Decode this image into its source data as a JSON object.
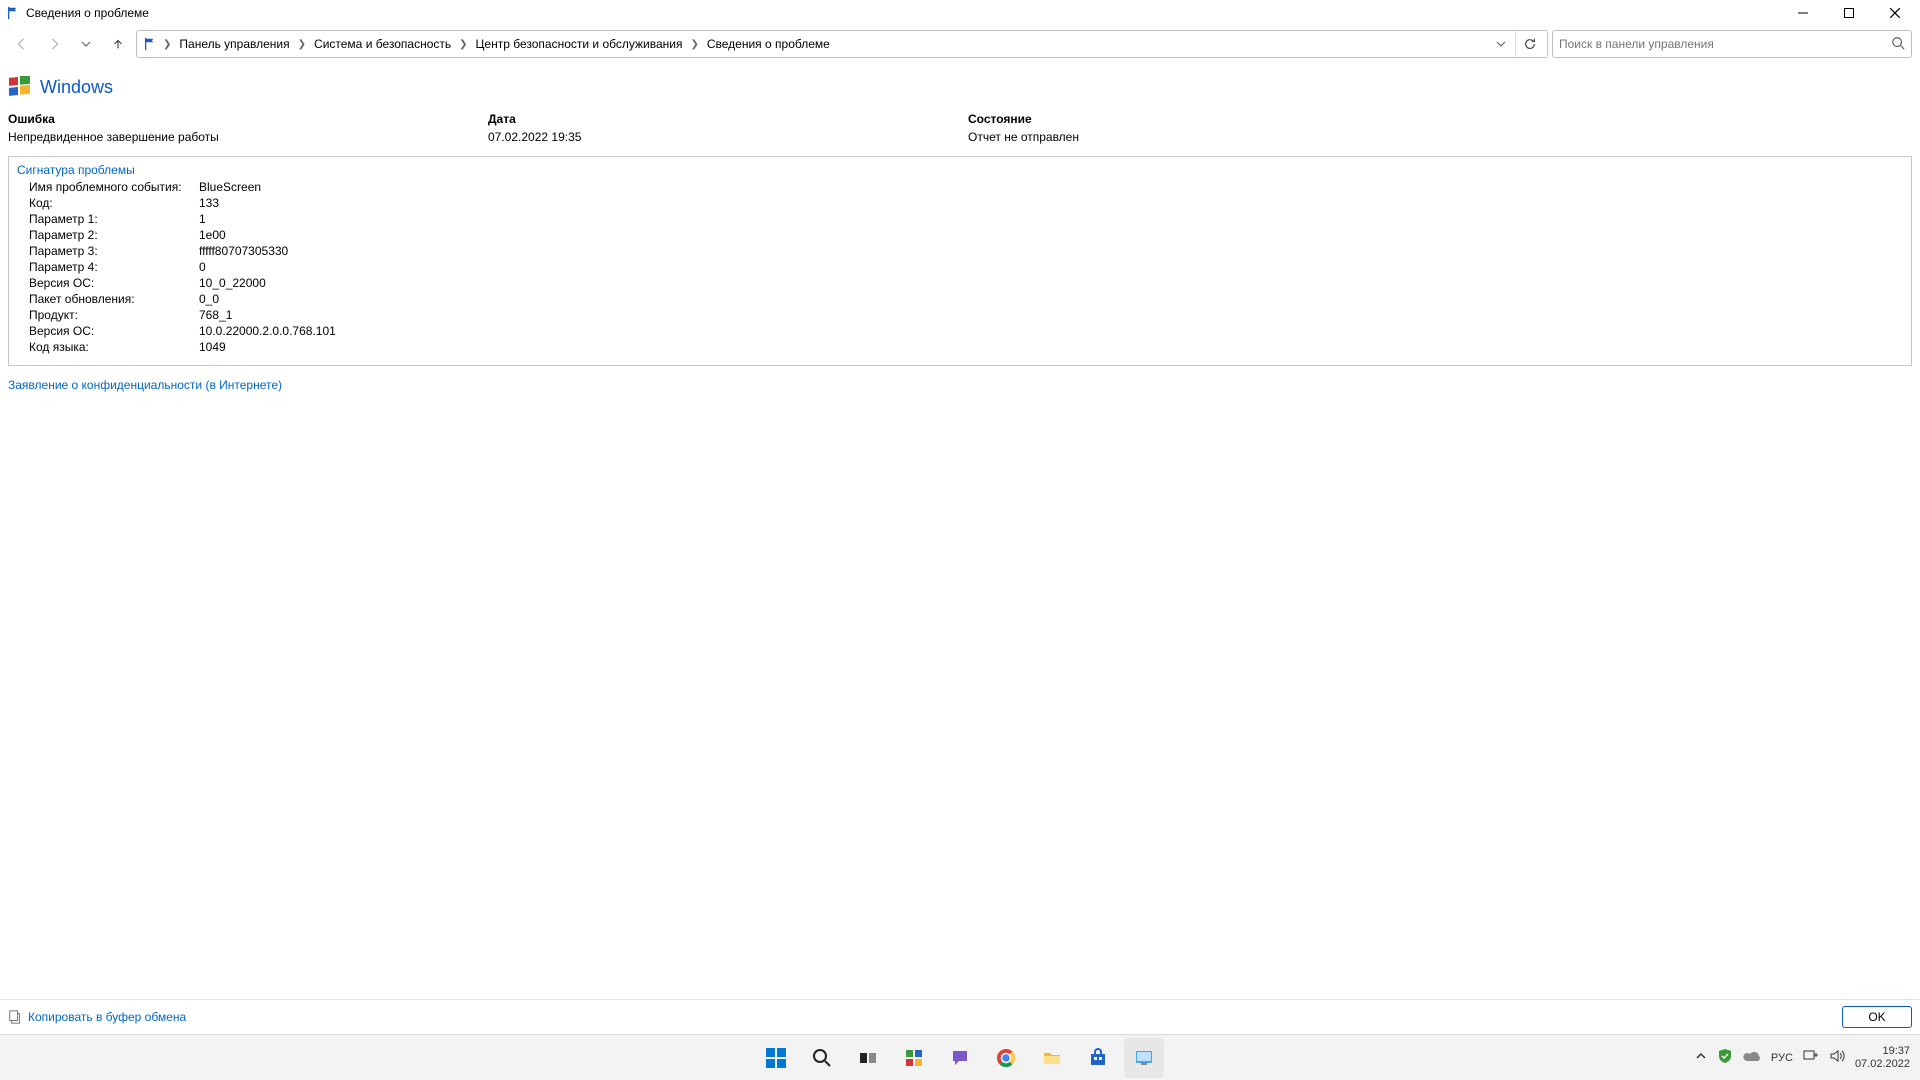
{
  "window": {
    "title": "Сведения о проблеме"
  },
  "breadcrumb": {
    "items": [
      "Панель управления",
      "Система и безопасность",
      "Центр безопасности и обслуживания",
      "Сведения о проблеме"
    ]
  },
  "search": {
    "placeholder": "Поиск в панели управления"
  },
  "header": {
    "app_name": "Windows"
  },
  "summary": {
    "error_label": "Ошибка",
    "error_value": "Непредвиденное завершение работы",
    "date_label": "Дата",
    "date_value": "07.02.2022 19:35",
    "state_label": "Состояние",
    "state_value": "Отчет не отправлен"
  },
  "signature": {
    "title": "Сигнатура проблемы",
    "rows": [
      {
        "k": "Имя проблемного события:",
        "v": "BlueScreen"
      },
      {
        "k": "Код:",
        "v": "133"
      },
      {
        "k": "Параметр 1:",
        "v": "1"
      },
      {
        "k": "Параметр 2:",
        "v": "1e00"
      },
      {
        "k": "Параметр 3:",
        "v": "fffff80707305330"
      },
      {
        "k": "Параметр 4:",
        "v": "0"
      },
      {
        "k": "Версия ОС:",
        "v": "10_0_22000"
      },
      {
        "k": "Пакет обновления:",
        "v": "0_0"
      },
      {
        "k": "Продукт:",
        "v": "768_1"
      },
      {
        "k": "Версия ОС:",
        "v": "10.0.22000.2.0.0.768.101"
      },
      {
        "k": "Код языка:",
        "v": "1049"
      }
    ]
  },
  "links": {
    "privacy": "Заявление о конфиденциальности (в Интернете)",
    "copy": "Копировать в буфер обмена"
  },
  "buttons": {
    "ok": "OK"
  },
  "tray": {
    "lang": "РУС",
    "time": "19:37",
    "date": "07.02.2022"
  }
}
